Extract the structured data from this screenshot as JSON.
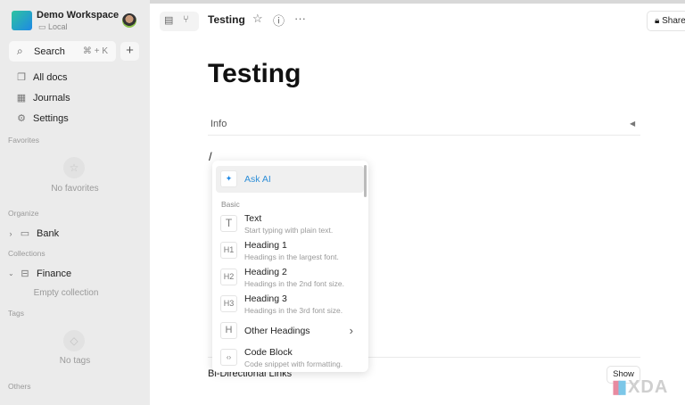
{
  "workspace": {
    "name": "Demo Workspace",
    "location": "Local"
  },
  "search": {
    "label": "Search",
    "shortcut": "⌘ + K"
  },
  "nav": [
    {
      "label": "All docs"
    },
    {
      "label": "Journals"
    },
    {
      "label": "Settings"
    }
  ],
  "sections": {
    "favorites": "Favorites",
    "no_favorites": "No favorites",
    "organize": "Organize",
    "folder": "Bank",
    "collections": "Collections",
    "collection": "Finance",
    "empty_collection": "Empty collection",
    "tags": "Tags",
    "no_tags": "No tags",
    "others": "Others"
  },
  "header": {
    "title": "Testing",
    "share": "Share"
  },
  "doc": {
    "title": "Testing",
    "info": "Info",
    "slash": "/",
    "bidirectional": "Bi-Directional Links",
    "show": "Show"
  },
  "menu": {
    "ask_ai": "Ask AI",
    "group": "Basic",
    "items": [
      {
        "icon": "T",
        "title": "Text",
        "desc": "Start typing with plain text."
      },
      {
        "icon": "H1",
        "title": "Heading 1",
        "desc": "Headings in the largest font."
      },
      {
        "icon": "H2",
        "title": "Heading 2",
        "desc": "Headings in the 2nd font size."
      },
      {
        "icon": "H3",
        "title": "Heading 3",
        "desc": "Headings in the 3rd font size."
      },
      {
        "icon": "H",
        "title": "Other Headings",
        "desc": ""
      },
      {
        "icon": "‹›",
        "title": "Code Block",
        "desc": "Code snippet with formatting."
      }
    ]
  },
  "watermark": "XDA"
}
